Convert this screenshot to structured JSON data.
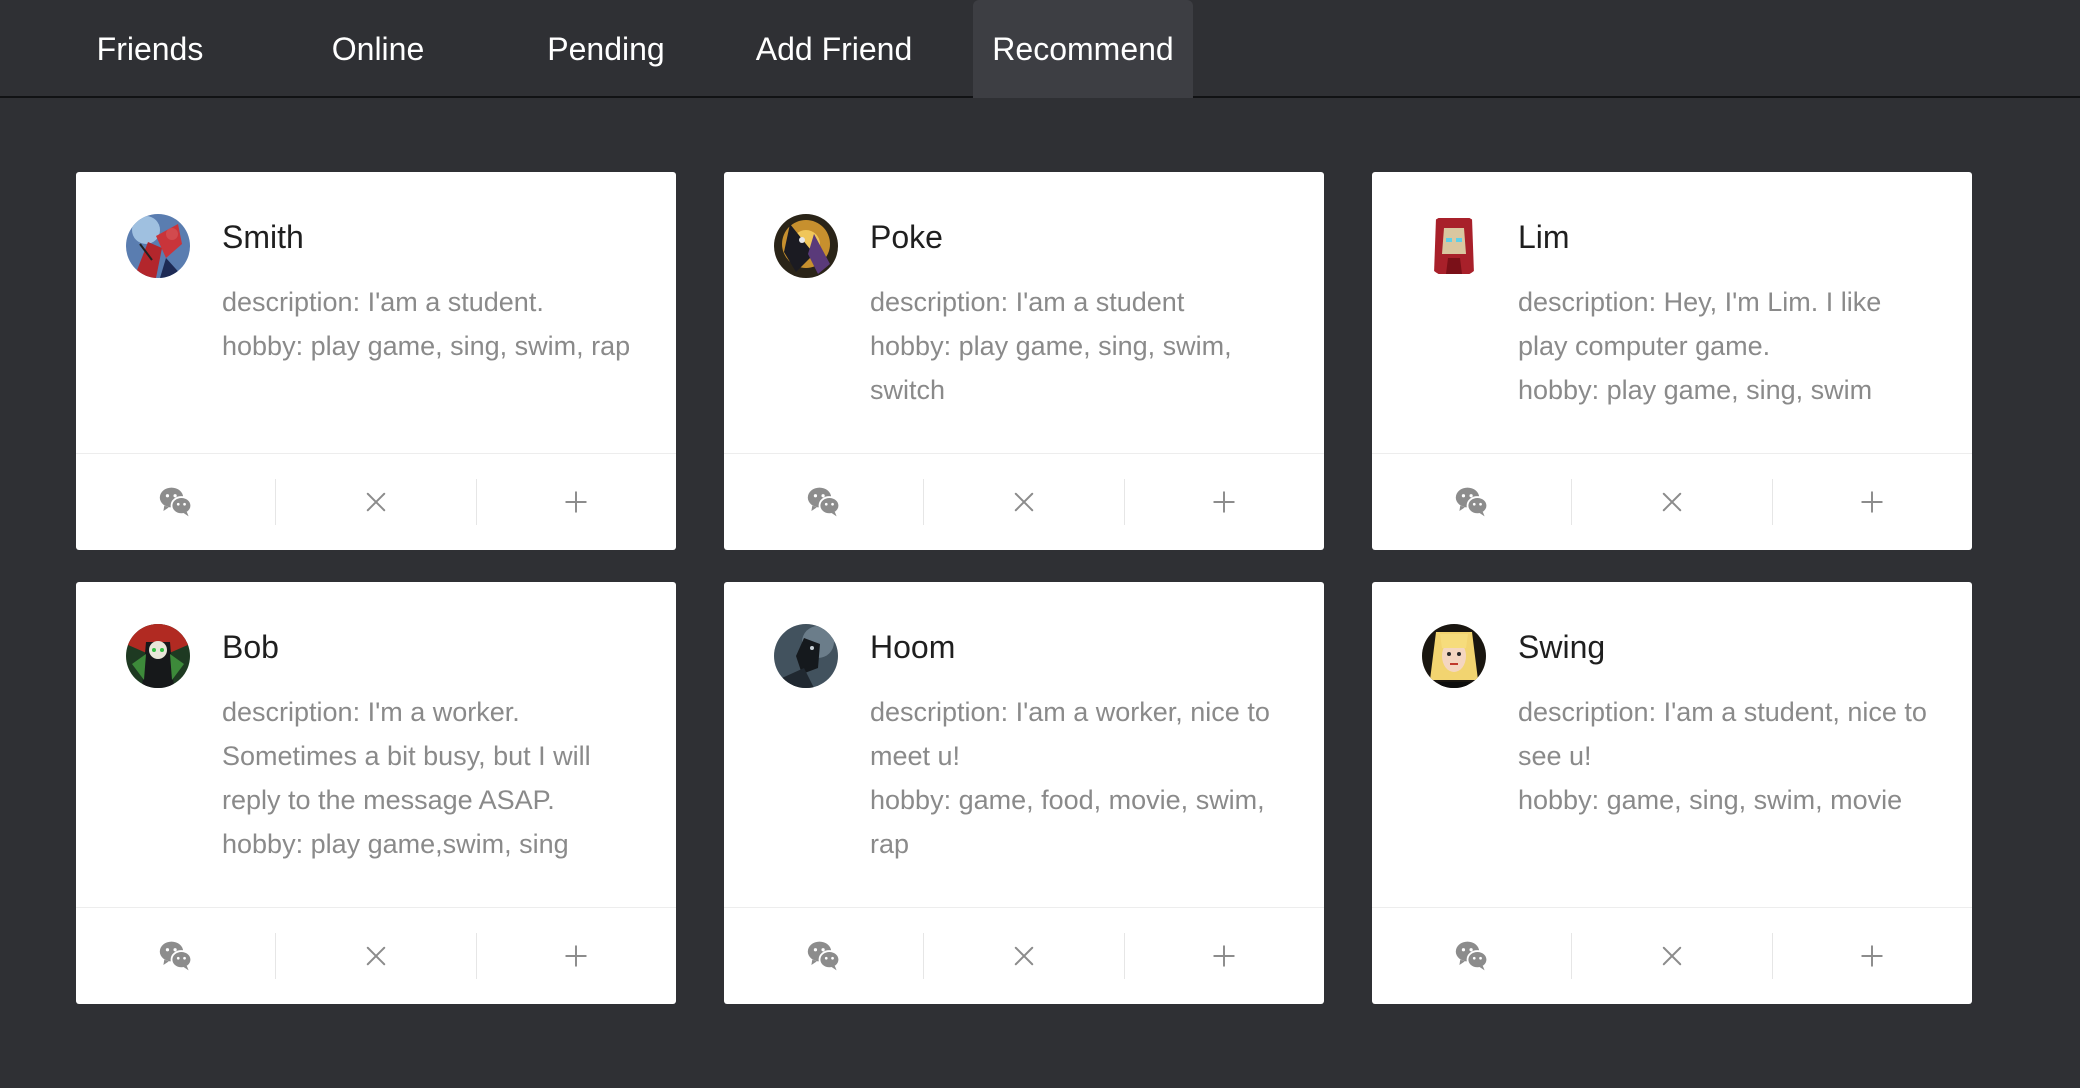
{
  "nav": {
    "tabs": [
      {
        "label": "Friends"
      },
      {
        "label": "Online"
      },
      {
        "label": "Pending"
      },
      {
        "label": "Add Friend"
      },
      {
        "label": "Recommend",
        "active": true
      }
    ]
  },
  "colors": {
    "background": "#2f3034",
    "active_tab": "#3d3e43",
    "card": "#ffffff",
    "icon": "#8c8c8c",
    "name_text": "#1f1f1f",
    "desc_text": "#8a8a8a"
  },
  "cards": [
    {
      "name": "Smith",
      "avatar": "avatar-smith",
      "description": "description: I'am a student.",
      "hobby": "hobby: play game, sing, swim, rap",
      "actions": [
        "wechat-icon",
        "close-icon",
        "plus-icon"
      ]
    },
    {
      "name": "Poke",
      "avatar": "avatar-poke",
      "description": "description: I'am a student",
      "hobby": "hobby: play game, sing, swim, switch",
      "actions": [
        "wechat-icon",
        "close-icon",
        "plus-icon"
      ]
    },
    {
      "name": "Lim",
      "avatar": "avatar-lim",
      "description": "description: Hey, I'm Lim. I like play computer game.",
      "hobby": "hobby: play game, sing, swim",
      "actions": [
        "wechat-icon",
        "close-icon",
        "plus-icon"
      ]
    },
    {
      "name": "Bob",
      "avatar": "avatar-bob",
      "description": "description: I'm a worker. Sometimes a bit busy, but I will reply to the message ASAP.",
      "hobby": "hobby: play game,swim, sing",
      "actions": [
        "wechat-icon",
        "close-icon",
        "plus-icon"
      ]
    },
    {
      "name": "Hoom",
      "avatar": "avatar-hoom",
      "description": "description: I'am a worker, nice to meet u!",
      "hobby": "hobby: game, food, movie, swim, rap",
      "actions": [
        "wechat-icon",
        "close-icon",
        "plus-icon"
      ]
    },
    {
      "name": "Swing",
      "avatar": "avatar-swing",
      "description": "description: I'am a student, nice to see u!",
      "hobby": "hobby: game, sing, swim, movie",
      "actions": [
        "wechat-icon",
        "close-icon",
        "plus-icon"
      ]
    }
  ]
}
